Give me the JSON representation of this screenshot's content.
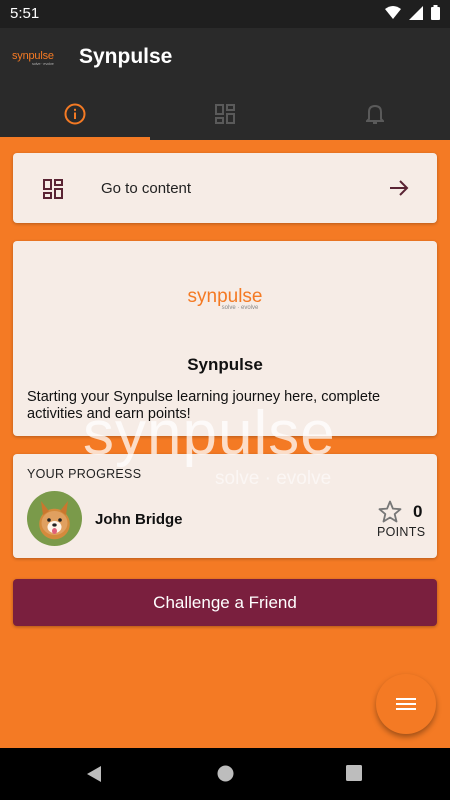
{
  "status_bar": {
    "time": "5:51"
  },
  "app_bar": {
    "logo_text": "synpulse",
    "logo_tagline": "solve · evolve",
    "title": "Synpulse"
  },
  "tabs": [
    {
      "icon": "info-icon",
      "active": true
    },
    {
      "icon": "dashboard-icon",
      "active": false
    },
    {
      "icon": "bell-icon",
      "active": false
    }
  ],
  "go_to_content": {
    "label": "Go to content"
  },
  "about_card": {
    "brand": "synpulse",
    "brand_tagline": "solve · evolve",
    "heading": "Synpulse",
    "description": "Starting your Synpulse learning journey here, complete activities and earn points!"
  },
  "watermark": {
    "text": "synpulse",
    "tagline": "solve · evolve"
  },
  "progress": {
    "label": "YOUR PROGRESS",
    "user_name": "John Bridge",
    "points": "0",
    "points_label": "POINTS"
  },
  "challenge_button": {
    "label": "Challenge a Friend"
  },
  "colors": {
    "accent": "#f47a24",
    "maroon": "#7a1f3e",
    "card": "#f6ece6",
    "bar": "#2a2a2a"
  }
}
